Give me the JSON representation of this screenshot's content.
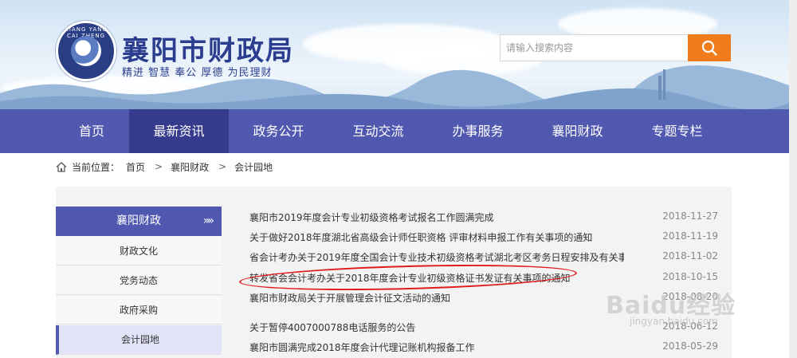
{
  "header": {
    "logo_ring_text": "XIANG YANG CAI ZHENG",
    "title": "襄阳市财政局",
    "slogan": "精进  智慧  奉公  厚德  为民理财",
    "search_placeholder": "请输入搜索内容",
    "search_icon": "search-icon"
  },
  "nav": {
    "items": [
      {
        "label": "首页"
      },
      {
        "label": "最新资讯"
      },
      {
        "label": "政务公开"
      },
      {
        "label": "互动交流"
      },
      {
        "label": "办事服务"
      },
      {
        "label": "襄阳财政"
      },
      {
        "label": "专题专栏"
      }
    ],
    "active_index": 1
  },
  "breadcrumb": {
    "home_icon": "home-icon",
    "prefix": "当前位置：",
    "items": [
      "首页",
      "襄阳财政",
      "会计园地"
    ],
    "separator": ">"
  },
  "sidebar": {
    "header": "襄阳财政",
    "arrow": "»»",
    "items": [
      {
        "label": "财政文化"
      },
      {
        "label": "党务动态"
      },
      {
        "label": "政府采购"
      },
      {
        "label": "会计园地"
      }
    ],
    "active_index": 3
  },
  "news": [
    {
      "title": "襄阳市2019年度会计专业初级资格考试报名工作圆满完成",
      "date": "2018-11-27"
    },
    {
      "title": "关于做好2018年度湖北省高级会计师任职资格 评审材料申报工作有关事项的通知",
      "date": "2018-11-19"
    },
    {
      "title": "省会计考办关于2019年度全国会计专业技术初级资格考试湖北考区考务日程安排及有关事...",
      "date": "2018-11-02"
    },
    {
      "title": "转发省会会计考办关于2018年度会计专业初级资格证书发证有关事项的通知",
      "date": "2018-10-15"
    },
    {
      "title": "襄阳市财政局关于开展管理会计征文活动的通知",
      "date": "2018-08-20"
    },
    {
      "title": "关于暂停4007000788电话服务的公告",
      "date": "2018-06-12"
    },
    {
      "title": "襄阳市圆满完成2018年度会计代理记账机构报备工作",
      "date": "2018-05-29"
    }
  ],
  "watermark": {
    "text": "Baidu经验",
    "sub": "jingyan.baidu.com"
  },
  "colors": {
    "nav_bg": "#5058b0",
    "nav_active": "#353c8e",
    "search_button": "#f07c1b",
    "title": "#2b3d8f",
    "highlight": "#e01b1b"
  }
}
